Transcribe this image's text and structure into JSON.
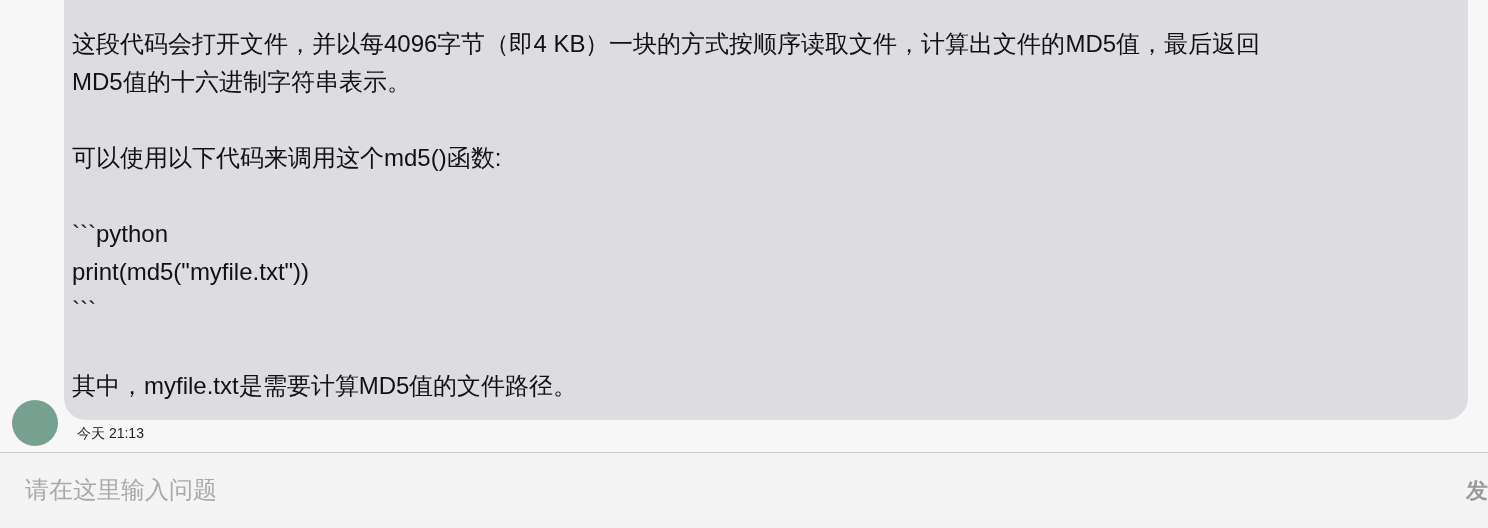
{
  "message": {
    "paragraphs": [
      "这段代码会打开文件，并以每4096字节（即4 KB）一块的方式按顺序读取文件，计算出文件的MD5值，最后返回\nMD5值的十六进制字符串表示。",
      "可以使用以下代码来调用这个md5()函数:",
      "```python\nprint(md5(\"myfile.txt\"))\n```",
      "其中，myfile.txt是需要计算MD5值的文件路径。"
    ],
    "timestamp": "今天 21:13"
  },
  "input": {
    "placeholder": "请在这里输入问题"
  },
  "send_button": "发"
}
